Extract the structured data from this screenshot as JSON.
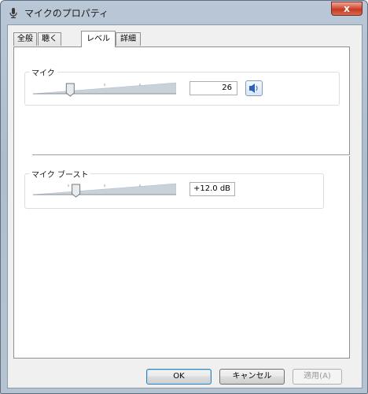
{
  "window": {
    "title": "マイクのプロパティ",
    "close_label": "x"
  },
  "tabs": [
    {
      "label": "全般",
      "selected": false
    },
    {
      "label": "聴く",
      "selected": false
    },
    {
      "label": "レベル",
      "selected": true
    },
    {
      "label": "詳細",
      "selected": false
    }
  ],
  "levels": {
    "mic": {
      "label": "マイク",
      "value": "26",
      "slider_fraction": 0.26,
      "mute_icon": "speaker-icon"
    },
    "boost": {
      "label": "マイク ブースト",
      "value": "+12.0 dB",
      "slider_fraction": 0.3
    }
  },
  "buttons": {
    "ok": "OK",
    "cancel": "キャンセル",
    "apply": "適用(A)"
  },
  "colors": {
    "titlebar": "#b9c7d6",
    "close": "#c23a22",
    "panel": "#ffffff",
    "dialog_bg": "#f0f0f0",
    "slider_track": "#c9d1d9",
    "mute_icon": "#2a63b8"
  }
}
